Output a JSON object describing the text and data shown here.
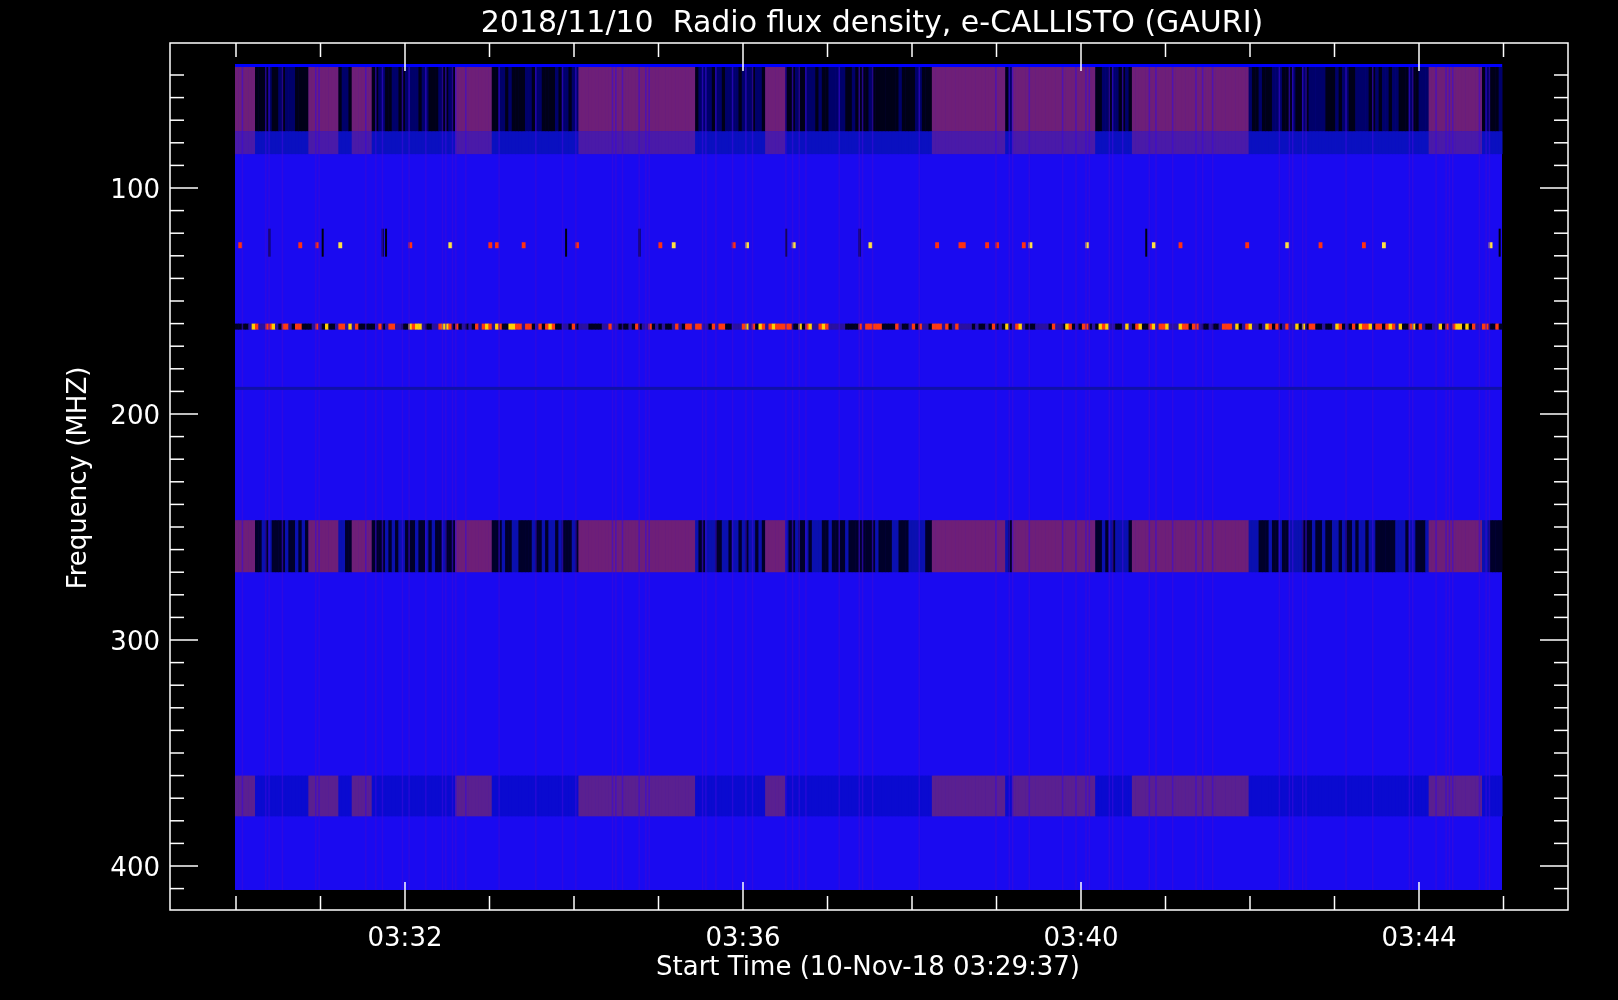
{
  "title": "2018/11/10  Radio flux density, e-CALLISTO (GAURI)",
  "y_axis": {
    "label": "Frequency (MHZ)",
    "ticks": [
      "100",
      "200",
      "300",
      "400"
    ]
  },
  "x_axis": {
    "label": "Start Time (10-Nov-18 03:29:37)",
    "ticks": [
      "03:32",
      "03:36",
      "03:40",
      "03:44"
    ]
  }
}
